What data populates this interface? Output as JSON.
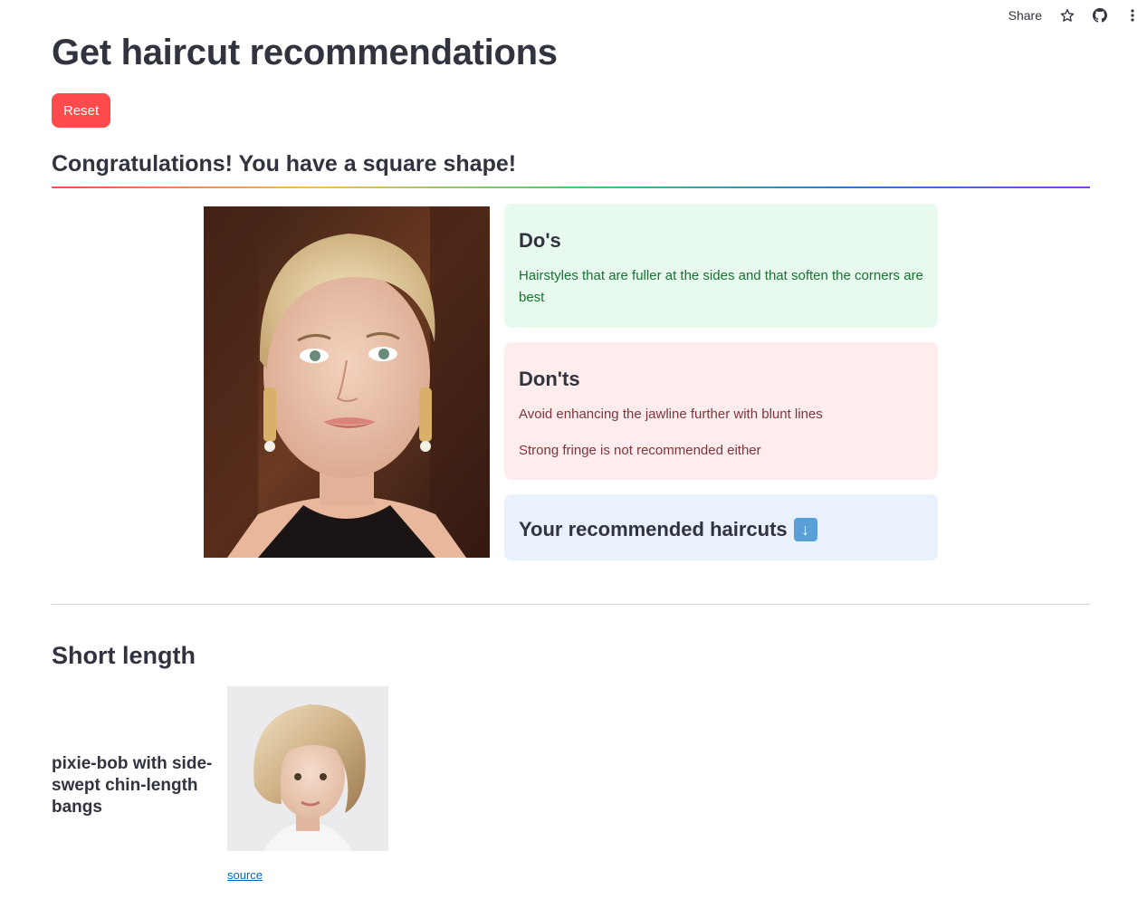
{
  "toolbar": {
    "share_label": "Share",
    "icons": [
      "star-icon",
      "github-icon",
      "more-vertical-icon"
    ]
  },
  "page": {
    "title": "Get haircut recommendations",
    "reset_label": "Reset",
    "congrats": "Congratulations! You have a square shape!"
  },
  "dos": {
    "heading": "Do's",
    "text": "Hairstyles that are fuller at the sides and that soften the corners are best"
  },
  "donts": {
    "heading": "Don'ts",
    "items": [
      "Avoid enhancing the jawline further with blunt lines",
      "Strong fringe is not recommended either"
    ]
  },
  "recommended": {
    "heading": "Your recommended haircuts",
    "icon": "down-arrow-icon"
  },
  "section": {
    "title": "Short length",
    "haircut_name": "pixie-bob with side-swept chin-length bangs",
    "source_label": "source"
  },
  "colors": {
    "primary": "#ff4b4b",
    "success_bg": "#e8f9ee",
    "success_text": "#177233",
    "error_bg": "#ffeded",
    "error_text": "#7d353b",
    "info_bg": "#e8f1fc",
    "link": "#0068c9"
  }
}
